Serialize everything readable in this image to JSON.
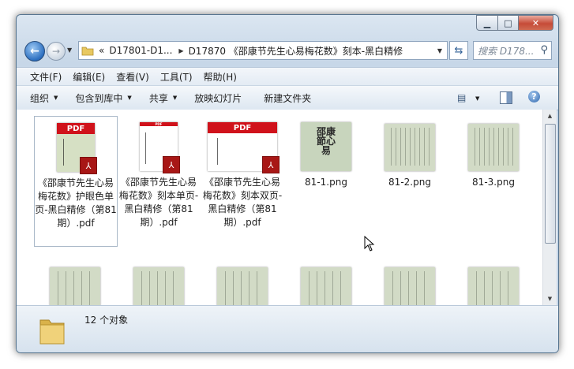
{
  "window": {
    "caption_buttons": [
      "minimize",
      "maximize",
      "close"
    ]
  },
  "nav": {
    "breadcrumb_overflow": "«",
    "crumbs": [
      "D17801-D1...",
      "D17870 《邵康节先生心易梅花数》刻本-黑白精修"
    ],
    "search_placeholder": "搜索 D178..."
  },
  "menu": {
    "items": [
      "文件(F)",
      "编辑(E)",
      "查看(V)",
      "工具(T)",
      "帮助(H)"
    ]
  },
  "toolbar": {
    "organize": "组织",
    "include_library": "包含到库中",
    "share": "共享",
    "slideshow": "放映幻灯片",
    "new_folder": "新建文件夹"
  },
  "files": [
    {
      "name": "《邵康节先生心易梅花数》护眼色单页-黑白精修（第81期）.pdf",
      "type": "pdf",
      "badge": "PDF"
    },
    {
      "name": "《邵康节先生心易梅花数》刻本单页-黑白精修（第81期）.pdf",
      "type": "pdf",
      "badge": "PDF"
    },
    {
      "name": "《邵康节先生心易梅花数》刻本双页-黑白精修（第81期）.pdf",
      "type": "pdf",
      "badge": "PDF"
    },
    {
      "name": "81-1.png",
      "type": "png",
      "cover_text": "邵康節心易"
    },
    {
      "name": "81-2.png",
      "type": "png"
    },
    {
      "name": "81-3.png",
      "type": "png"
    }
  ],
  "status": {
    "count": "12 个对象"
  },
  "colors": {
    "pdf_red": "#d0121b",
    "page_green": "#d2dbc6",
    "chrome_blue": "#c7d7e8"
  }
}
